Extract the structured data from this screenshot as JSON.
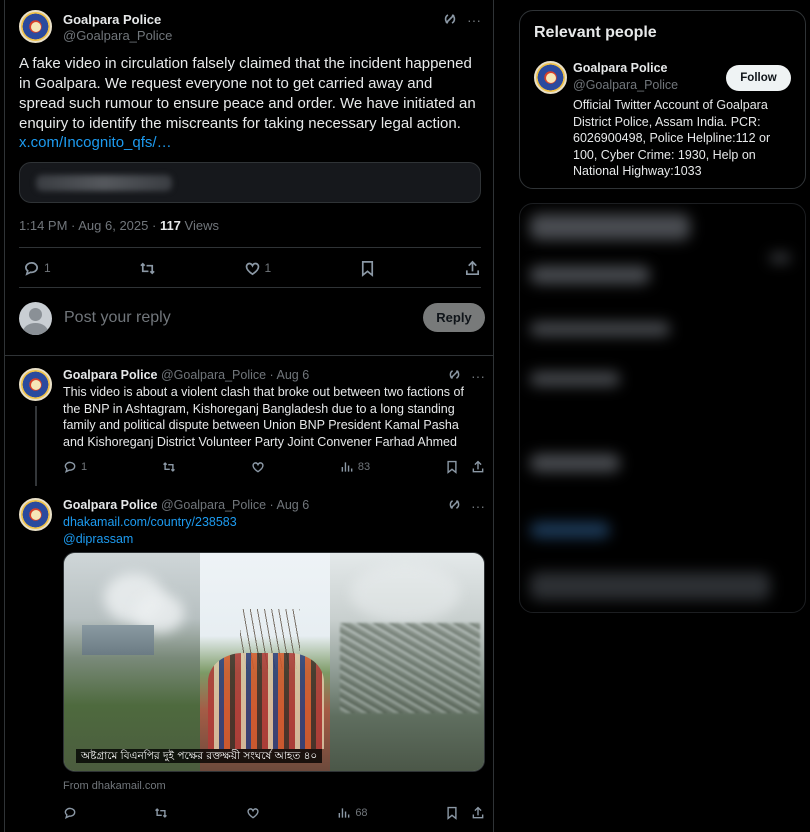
{
  "focus": {
    "name": "Goalpara Police",
    "handle": "@Goalpara_Police",
    "text": "A fake video in circulation falsely claimed that the incident happened in Goalpara. We request everyone not to get carried away and spread such rumour to ensure peace and order. We have initiated an enquiry to identify the miscreants for taking necessary legal action.",
    "link": "x.com/Incognito_qfs/…",
    "time": "1:14 PM · Aug 6, 2025 ·",
    "views_count": "117",
    "views_label": "Views",
    "replies": "1",
    "likes": "1"
  },
  "reply_box": {
    "placeholder": "Post your reply",
    "button": "Reply"
  },
  "tweets": [
    {
      "name": "Goalpara Police",
      "handle_date": "@Goalpara_Police · Aug 6",
      "text": "This video is about a violent clash that broke out between two factions of the BNP in Ashtagram, Kishoreganj Bangladesh due to a long standing family and political dispute between Union BNP President Kamal Pasha and Kishoreganj District Volunteer Party Joint Convener Farhad Ahmed",
      "replies": "1",
      "views": "83"
    },
    {
      "name": "Goalpara Police",
      "handle_date": "@Goalpara_Police · Aug 6",
      "link1": "dhakamail.com/country/238583",
      "link2": "@diprassam",
      "media_caption": "অষ্টগ্রামে বিএনপির দুই পক্ষের রক্তক্ষয়ী সংঘর্ষে আহত ৪০",
      "from": "From dhakamail.com",
      "views": "68"
    }
  ],
  "sidebar": {
    "title": "Relevant people",
    "name": "Goalpara Police",
    "handle": "@Goalpara_Police",
    "follow": "Follow",
    "bio": "Official Twitter Account of Goalpara District Police, Assam India. PCR: 6026900498, Police Helpline:112 or 100, Cyber Crime: 1930, Help on National Highway:1033"
  },
  "icons": {
    "grok": "grok-icon",
    "more": "more-icon",
    "reply": "reply-icon",
    "repost": "repost-icon",
    "like": "like-icon",
    "bookmark": "bookmark-icon",
    "share": "share-icon",
    "views": "views-icon"
  }
}
